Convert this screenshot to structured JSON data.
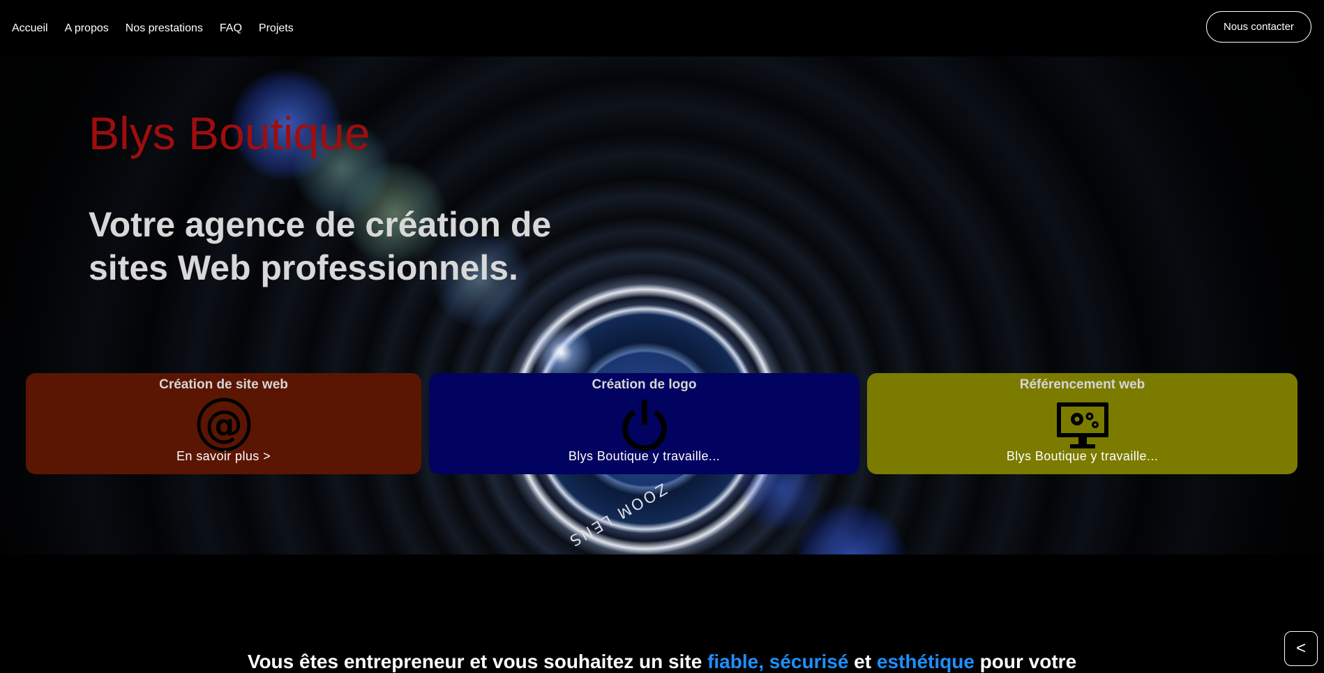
{
  "nav": {
    "links": [
      "Accueil",
      "A propos",
      "Nos prestations",
      "FAQ",
      "Projets"
    ],
    "contact_label": "Nous contacter"
  },
  "hero": {
    "title": "Blys Boutique",
    "subtitle": "Votre agence de création de sites Web professionnels.",
    "lens_text": "ZOOM LENS"
  },
  "cards": [
    {
      "title": "Création de site web",
      "icon": "at-sign-icon",
      "link": "En savoir plus >",
      "color": "#5a1602"
    },
    {
      "title": "Création de logo",
      "icon": "power-icon",
      "link": "Blys Boutique y travaille...",
      "color": "#020260"
    },
    {
      "title": "Référencement web",
      "icon": "monitor-gears-icon",
      "link": "Blys Boutique y travaille...",
      "color": "#7b7b00"
    }
  ],
  "intro": {
    "part1": "Vous êtes entrepreneur et vous souhaitez un site ",
    "word1": "fiable",
    "sep1": ", ",
    "word2": "sécurisé",
    "sep2": " et ",
    "word3": "esthétique",
    "part2": " pour votre"
  },
  "back_button_label": "<",
  "colors": {
    "title_red": "#a00d0d",
    "highlight_blue": "#1e90ff"
  }
}
